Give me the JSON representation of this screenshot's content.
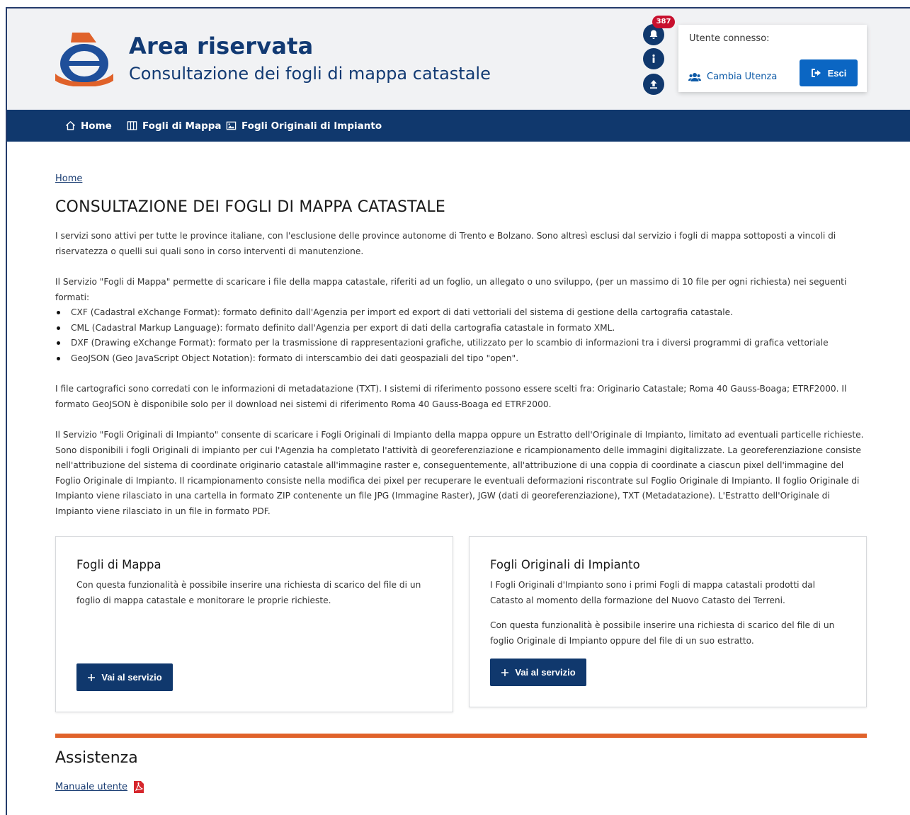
{
  "header": {
    "title": "Area riservata",
    "subtitle": "Consultazione dei fogli di mappa catastale",
    "notification_count": "387",
    "user_box": {
      "label": "Utente connesso:",
      "switch_label": "Cambia Utenza",
      "logout_label": "Esci"
    }
  },
  "nav": {
    "items": [
      {
        "label": "Home",
        "icon": "home-icon"
      },
      {
        "label": "Fogli di Mappa",
        "icon": "map-columns-icon"
      },
      {
        "label": "Fogli Originali di Impianto",
        "icon": "image-icon"
      }
    ]
  },
  "main": {
    "breadcrumb": "Home",
    "title": "CONSULTAZIONE DEI FOGLI DI MAPPA CATASTALE",
    "paragraphs": [
      "I servizi sono attivi per tutte le province italiane, con l'esclusione delle province autonome di Trento e Bolzano. Sono altresì esclusi dal servizio i fogli di mappa sottoposti a vincoli di riservatezza o quelli sui quali sono in corso interventi di manutenzione.",
      "Il Servizio \"Fogli di Mappa\" permette di scaricare i file della mappa catastale, riferiti ad un foglio, un allegato o uno sviluppo, (per un massimo di 10 file per ogni richiesta) nei seguenti formati:",
      "I file cartografici sono corredati con le informazioni di metadatazione (TXT). I sistemi di riferimento possono essere scelti fra: Originario Catastale; Roma 40 Gauss-Boaga; ETRF2000. Il formato GeoJSON è disponibile solo per il download nei sistemi di riferimento Roma 40 Gauss-Boaga ed ETRF2000.",
      "Il Servizio \"Fogli Originali di Impianto\" consente di scaricare i Fogli Originali di Impianto della mappa oppure un Estratto dell'Originale di Impianto, limitato ad eventuali particelle richieste. Sono disponibili i fogli Originali di impianto per cui l'Agenzia ha completato l'attività di georeferenziazione e ricampionamento delle immagini digitalizzate. La georeferenziazione consiste nell'attribuzione del sistema di coordinate originario catastale all'immagine raster e, conseguentemente, all'attribuzione di una coppia di coordinate a ciascun pixel dell'immagine del Foglio Originale di Impianto. Il ricampionamento consiste nella modifica dei pixel per recuperare le eventuali deformazioni riscontrate sul Foglio Originale di Impianto. Il foglio Originale di Impianto viene rilasciato in una cartella in formato ZIP contenente un file JPG (Immagine Raster), JGW (dati di georeferenziazione), TXT (Metadatazione). L'Estratto dell'Originale di Impianto viene rilasciato in un file in formato PDF."
    ],
    "formats": [
      "CXF (Cadastral eXchange Format): formato definito dall'Agenzia per import ed export di dati vettoriali del sistema di gestione della cartografia catastale.",
      "CML (Cadastral Markup Language): formato definito dall'Agenzia per export di dati della cartografia catastale in formato XML.",
      "DXF (Drawing eXchange Format): formato per la trasmissione di rappresentazioni grafiche, utilizzato per lo scambio di informazioni tra i diversi programmi di grafica vettoriale",
      "GeoJSON (Geo JavaScript Object Notation): formato di interscambio dei dati geospaziali del tipo \"open\"."
    ],
    "cards": [
      {
        "title": "Fogli di Mappa",
        "texts": [
          "Con questa funzionalità è possibile inserire una richiesta di scarico del file di un foglio di mappa catastale e monitorare le proprie richieste."
        ],
        "button": "Vai al servizio"
      },
      {
        "title": "Fogli Originali di Impianto",
        "texts": [
          "I Fogli Originali d'Impianto sono i primi Fogli di mappa catastali prodotti dal Catasto al momento della formazione del Nuovo Catasto dei Terreni.",
          "Con questa funzionalità è possibile inserire una richiesta di scarico del file di un foglio Originale di Impianto oppure del file di un suo estratto."
        ],
        "button": "Vai al servizio"
      }
    ]
  },
  "assistance": {
    "title": "Assistenza",
    "manual_link": "Manuale utente"
  },
  "colors": {
    "brand_blue": "#10386d",
    "button_blue": "#0b66c3",
    "accent_orange": "#e0622a",
    "badge_red": "#c8102e"
  }
}
